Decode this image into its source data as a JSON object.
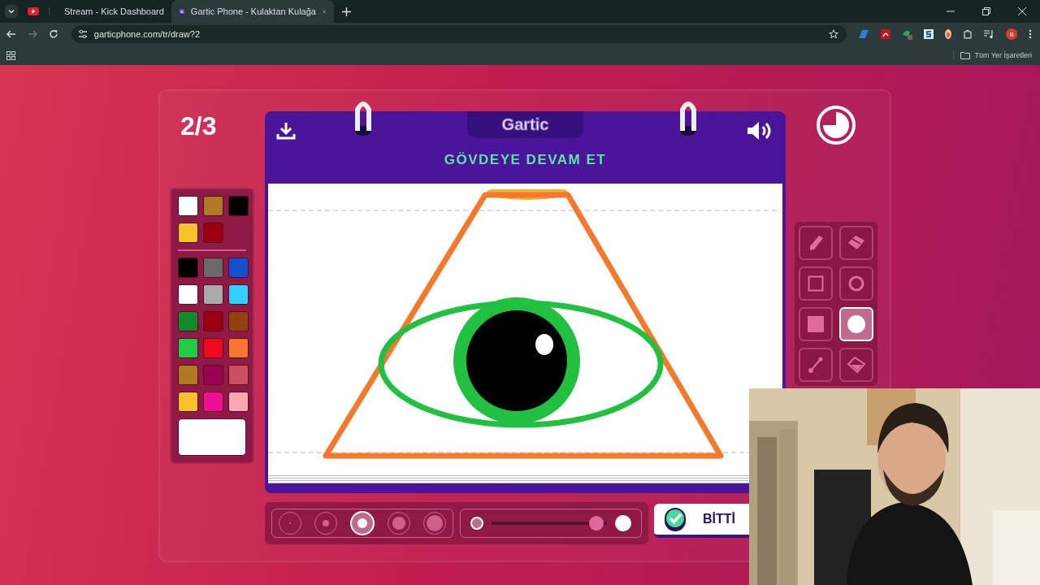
{
  "browser": {
    "tabs": [
      {
        "title": "Stream - Kick Dashboard",
        "selected": false
      },
      {
        "title": "Gartic Phone - Kulaktan Kulağa",
        "selected": true
      }
    ],
    "url": "garticphone.com/tr/draw?2",
    "profile_initial": "B",
    "bookmarks_label": "Tüm Yer İşaretleri"
  },
  "game": {
    "round": "2/3",
    "logo": "Gartic",
    "prompt": "GÖVDEYE DEVAM ET",
    "recent_colors": [
      {
        "color": "#ffffff"
      },
      {
        "color": "#b07a24"
      },
      {
        "color": "#000000"
      },
      {
        "color": "#f7c12a"
      },
      {
        "color": "#9a0010"
      }
    ],
    "colors": [
      {
        "color": "#000000"
      },
      {
        "color": "#6a6a6a"
      },
      {
        "color": "#1450d2"
      },
      {
        "color": "#ffffff"
      },
      {
        "color": "#aaaaaa"
      },
      {
        "color": "#30d0ff"
      },
      {
        "color": "#118a2a"
      },
      {
        "color": "#9a0010"
      },
      {
        "color": "#94400f"
      },
      {
        "color": "#22cc48"
      },
      {
        "color": "#ee0a1c"
      },
      {
        "color": "#f5782e"
      },
      {
        "color": "#b07a24"
      },
      {
        "color": "#990050"
      },
      {
        "color": "#cc5060"
      },
      {
        "color": "#f7c12a"
      },
      {
        "color": "#ee0f92"
      },
      {
        "color": "#f8a8b0"
      }
    ],
    "current": {
      "color": "#ffffff"
    },
    "tools": [
      {
        "kind": "pencil",
        "selected": false
      },
      {
        "kind": "eraser",
        "selected": false
      },
      {
        "kind": "rectangle",
        "selected": false
      },
      {
        "kind": "ellipse",
        "selected": false
      },
      {
        "kind": "filled-rectangle",
        "selected": false
      },
      {
        "kind": "filled-ellipse",
        "selected": true
      },
      {
        "kind": "line",
        "selected": false
      },
      {
        "kind": "bucket",
        "selected": false
      }
    ],
    "brush_sizes": [
      {
        "selected": false
      },
      {
        "selected": false
      },
      {
        "selected": true
      },
      {
        "selected": false
      },
      {
        "selected": false
      }
    ],
    "opacity": {
      "level": 0.97
    },
    "done_button": "BİTTİ"
  }
}
